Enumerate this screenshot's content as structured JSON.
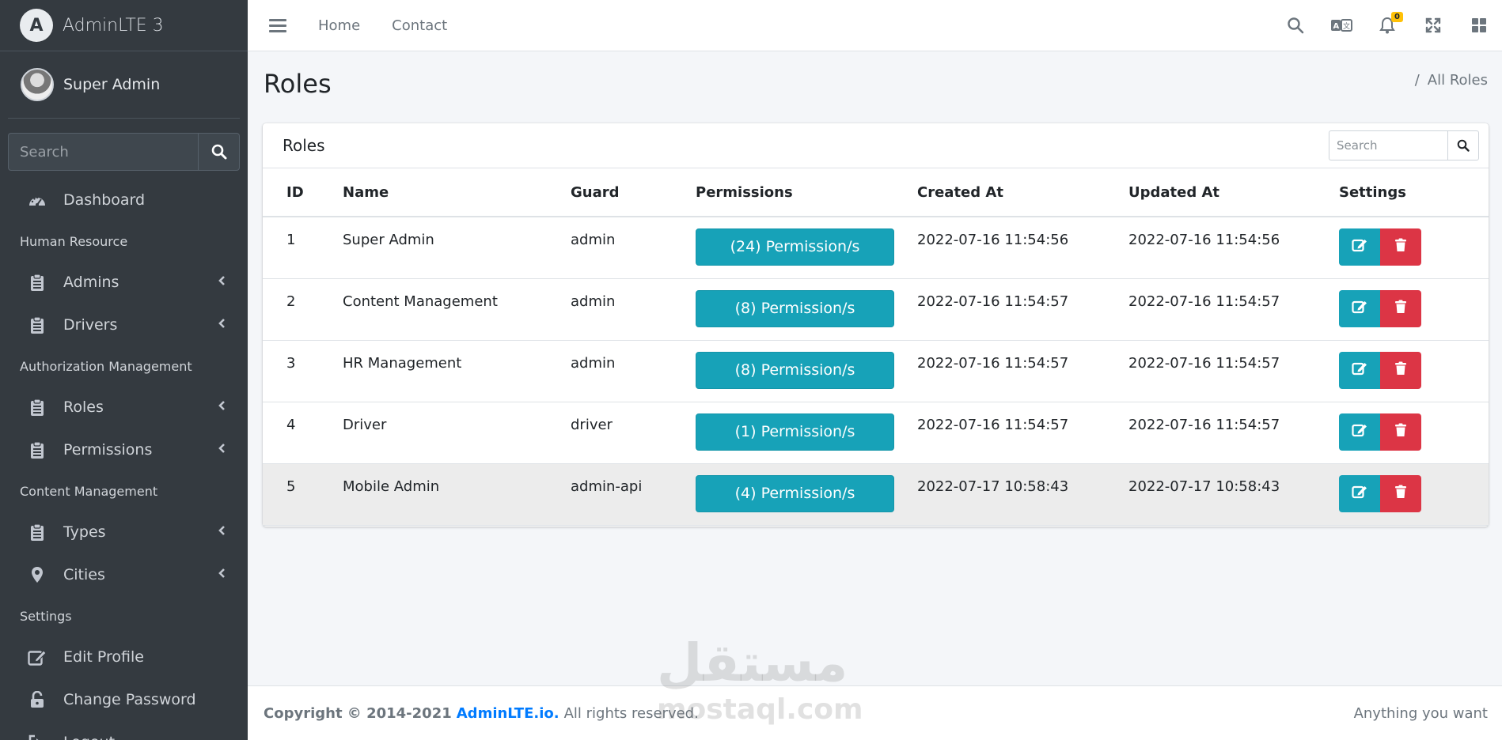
{
  "brand": {
    "logo_letter": "A",
    "name": "AdminLTE 3"
  },
  "user": {
    "name": "Super Admin"
  },
  "sidebar": {
    "search_placeholder": "Search",
    "items": [
      {
        "type": "item",
        "label": "Dashboard",
        "icon": "tachometer-icon",
        "submenu": false
      },
      {
        "type": "header",
        "label": "Human Resource"
      },
      {
        "type": "item",
        "label": "Admins",
        "icon": "clipboard-icon",
        "submenu": true
      },
      {
        "type": "item",
        "label": "Drivers",
        "icon": "clipboard-icon",
        "submenu": true
      },
      {
        "type": "header",
        "label": "Authorization Management"
      },
      {
        "type": "item",
        "label": "Roles",
        "icon": "clipboard-icon",
        "submenu": true
      },
      {
        "type": "item",
        "label": "Permissions",
        "icon": "clipboard-icon",
        "submenu": true
      },
      {
        "type": "header",
        "label": "Content Management"
      },
      {
        "type": "item",
        "label": "Types",
        "icon": "clipboard-icon",
        "submenu": true
      },
      {
        "type": "item",
        "label": "Cities",
        "icon": "map-marker-icon",
        "submenu": true
      },
      {
        "type": "header",
        "label": "Settings"
      },
      {
        "type": "item",
        "label": "Edit Profile",
        "icon": "edit-icon",
        "submenu": false
      },
      {
        "type": "item",
        "label": "Change Password",
        "icon": "lock-icon",
        "submenu": false
      },
      {
        "type": "item",
        "label": "Logout",
        "icon": "sign-out-icon",
        "submenu": false
      }
    ]
  },
  "topbar": {
    "links": [
      "Home",
      "Contact"
    ],
    "notification_count": "0"
  },
  "page": {
    "title": "Roles",
    "breadcrumb": "All Roles"
  },
  "card": {
    "title": "Roles",
    "search_placeholder": "Search",
    "columns": [
      "ID",
      "Name",
      "Guard",
      "Permissions",
      "Created At",
      "Updated At",
      "Settings"
    ],
    "rows": [
      {
        "id": "1",
        "name": "Super Admin",
        "guard": "admin",
        "permissions": "(24) Permission/s",
        "created": "2022-07-16 11:54:56",
        "updated": "2022-07-16 11:54:56"
      },
      {
        "id": "2",
        "name": "Content Management",
        "guard": "admin",
        "permissions": "(8) Permission/s",
        "created": "2022-07-16 11:54:57",
        "updated": "2022-07-16 11:54:57"
      },
      {
        "id": "3",
        "name": "HR Management",
        "guard": "admin",
        "permissions": "(8) Permission/s",
        "created": "2022-07-16 11:54:57",
        "updated": "2022-07-16 11:54:57"
      },
      {
        "id": "4",
        "name": "Driver",
        "guard": "driver",
        "permissions": "(1) Permission/s",
        "created": "2022-07-16 11:54:57",
        "updated": "2022-07-16 11:54:57"
      },
      {
        "id": "5",
        "name": "Mobile Admin",
        "guard": "admin-api",
        "permissions": "(4) Permission/s",
        "created": "2022-07-17 10:58:43",
        "updated": "2022-07-17 10:58:43"
      }
    ]
  },
  "footer": {
    "copyright": "Copyright © 2014-2021",
    "link": "AdminLTE.io.",
    "rights": "All rights reserved.",
    "right_text": "Anything you want"
  },
  "watermark": {
    "arabic": "مستقل",
    "latin": "mostaql.com"
  },
  "colors": {
    "sidebar": "#343a40",
    "info": "#17a2b8",
    "danger": "#dc3545",
    "link": "#007bff",
    "badge": "#ffc107"
  }
}
